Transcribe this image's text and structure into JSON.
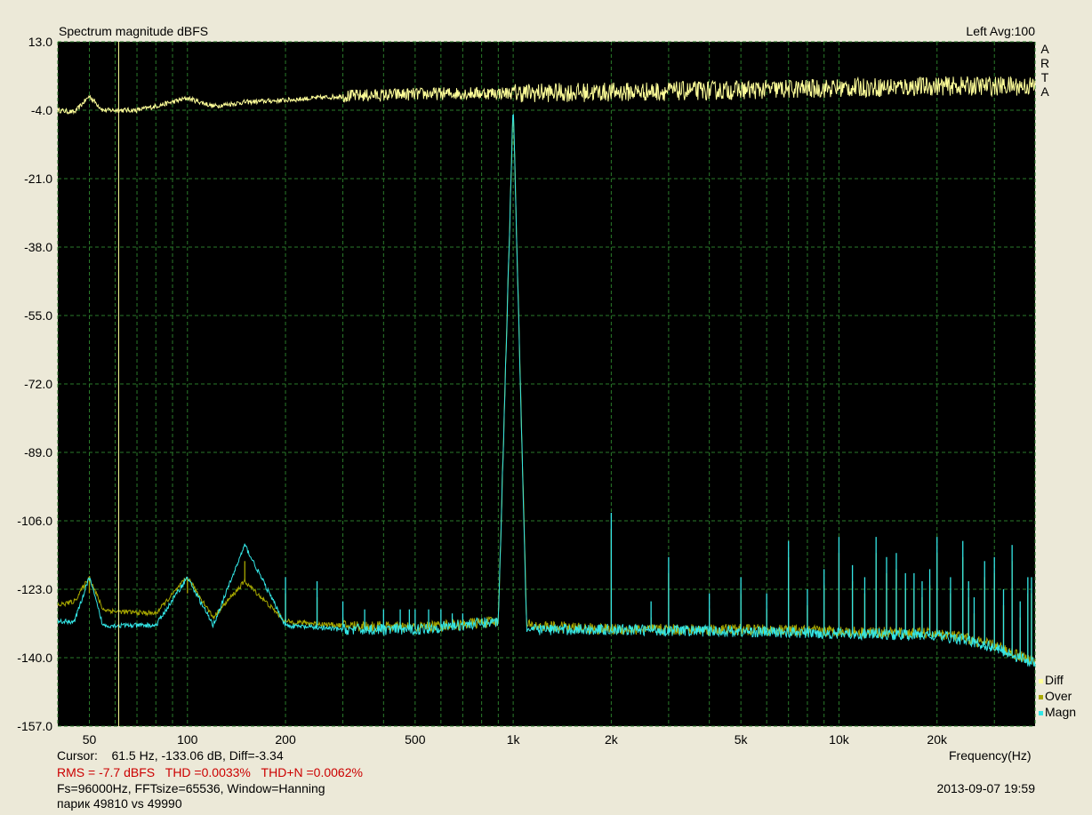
{
  "chart_data": {
    "type": "line",
    "title": "Spectrum magnitude dBFS",
    "channel_info": "Left  Avg:100",
    "xlabel": "Frequency(Hz)",
    "ylabel": "",
    "x_scale": "log",
    "xlim": [
      40,
      40000
    ],
    "ylim": [
      -157,
      13
    ],
    "y_ticks": [
      13,
      -4,
      -21,
      -38,
      -55,
      -72,
      -89,
      -106,
      -123,
      -140,
      -157
    ],
    "y_tick_labels": [
      "13.0",
      "-4.0",
      "-21.0",
      "-38.0",
      "-55.0",
      "-72.0",
      "-89.0",
      "-106.0",
      "-123.0",
      "-140.0",
      "-157.0"
    ],
    "x_ticks": [
      50,
      100,
      200,
      500,
      1000,
      2000,
      5000,
      10000,
      20000
    ],
    "x_tick_labels": [
      "50",
      "100",
      "200",
      "500",
      "1k",
      "2k",
      "5k",
      "10k",
      "20k"
    ],
    "grid": true,
    "cursor_x": 61.5,
    "series": [
      {
        "name": "Diff",
        "color": "#ffff99",
        "x": [
          40,
          45,
          50,
          55,
          60,
          70,
          80,
          100,
          120,
          150,
          200,
          300,
          500,
          700,
          1000,
          2000,
          5000,
          10000,
          20000,
          40000
        ],
        "y": [
          -4,
          -4.5,
          -0.5,
          -4,
          -4,
          -4,
          -3,
          -1,
          -3,
          -2,
          -1.5,
          -0.5,
          0,
          0.2,
          0.3,
          0.5,
          1,
          1.5,
          2,
          2
        ]
      },
      {
        "name": "Over",
        "color": "#a8a800",
        "x": [
          40,
          45,
          50,
          55,
          60,
          80,
          100,
          120,
          150,
          200,
          300,
          500,
          900,
          1000,
          1100,
          2000,
          5000,
          10000,
          20000,
          24000,
          30000,
          40000
        ],
        "y": [
          -127,
          -126,
          -120,
          -128,
          -128.5,
          -129,
          -120,
          -130,
          -121,
          -131,
          -132,
          -132.5,
          -131,
          -2,
          -132,
          -133,
          -133,
          -133.5,
          -134,
          -135,
          -137,
          -141
        ]
      },
      {
        "name": "Magn",
        "color": "#33e6e6",
        "x": [
          40,
          45,
          50,
          55,
          60,
          80,
          100,
          120,
          150,
          200,
          300,
          500,
          900,
          1000,
          1100,
          2000,
          5000,
          10000,
          20000,
          24000,
          30000,
          40000
        ],
        "y": [
          -131,
          -131,
          -120,
          -132,
          -132,
          -132,
          -120,
          -132,
          -112,
          -132,
          -133,
          -133,
          -131,
          -2,
          -133,
          -133,
          -133.5,
          -134,
          -134.5,
          -135.5,
          -137.5,
          -141.5
        ]
      }
    ],
    "harmonics": {
      "x": [
        50,
        100,
        150,
        200,
        250,
        300,
        350,
        400,
        450,
        480,
        500,
        550,
        600,
        650,
        700,
        2000,
        2650,
        3000,
        4000,
        5000,
        6000,
        7000,
        8000,
        9000,
        10000,
        11000,
        12000,
        13000,
        14000,
        15000,
        16000,
        17000,
        18000,
        19000,
        20000,
        22000,
        24000,
        25000,
        26000,
        28000,
        30000,
        32000,
        34000,
        36000,
        38000,
        39000
      ],
      "y": [
        -120,
        -120,
        -112,
        -120,
        -121,
        -126,
        -128,
        -128,
        -128,
        -128,
        -128,
        -128,
        -128,
        -129,
        -129,
        -104,
        -126,
        -115,
        -124,
        -120,
        -124,
        -111,
        -123,
        -118,
        -110,
        -117,
        -120,
        -110,
        -115,
        -114,
        -119,
        -119,
        -121,
        -118,
        -110,
        -120,
        -111,
        -121,
        -125,
        -116,
        -115,
        -123,
        -112,
        -126,
        -120,
        -120
      ]
    }
  },
  "cursor_readout": {
    "label": "Cursor:",
    "values": "61.5 Hz, -133.06 dB,  Diff=-3.34"
  },
  "stats": {
    "rms": "RMS =   -7.7 dBFS",
    "thd": "THD =0.0033%",
    "thd_n": "THD+N =0.0062%"
  },
  "params": "Fs=96000Hz, FFTsize=65536, Window=Hanning",
  "note": "парик  49810 vs 49990",
  "timestamp": "2013-09-07  19:59",
  "brand_letters": [
    "A",
    "R",
    "T",
    "A"
  ],
  "legend": [
    {
      "label": "Diff",
      "color": "#ffff99"
    },
    {
      "label": "Over",
      "color": "#a8a800"
    },
    {
      "label": "Magn",
      "color": "#33e6e6"
    }
  ]
}
